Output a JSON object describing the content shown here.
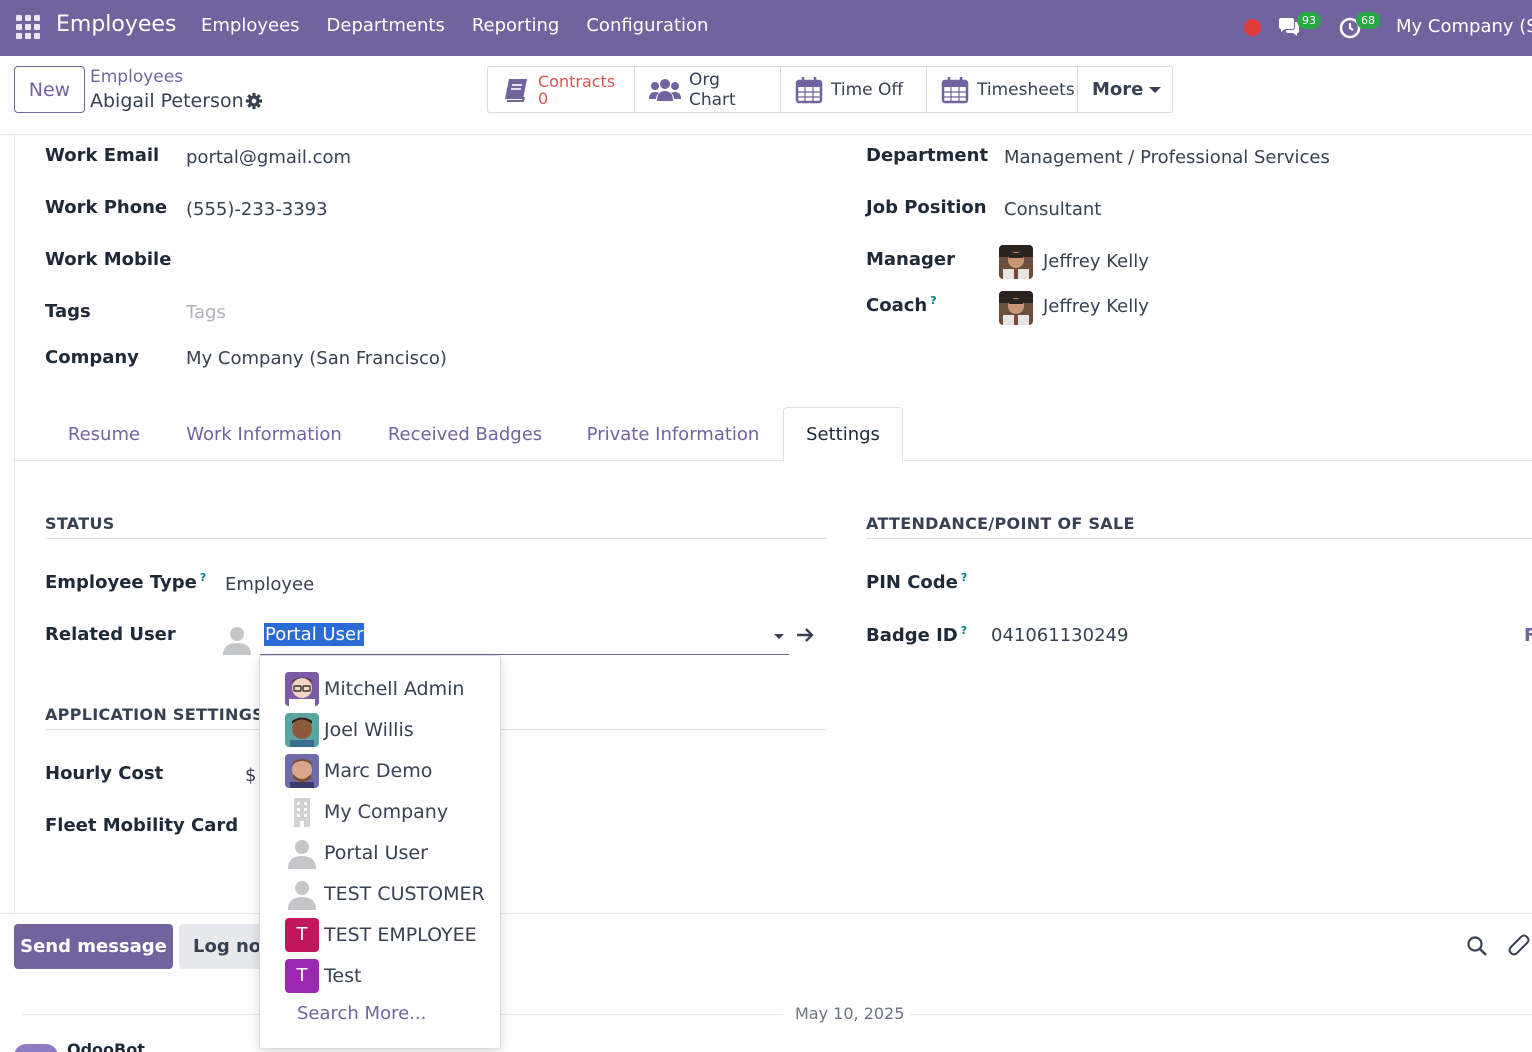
{
  "navbar": {
    "app_title": "Employees",
    "menu": [
      "Employees",
      "Departments",
      "Reporting",
      "Configuration"
    ],
    "chat_count": "93",
    "activity_count": "68",
    "company": "My Company (S"
  },
  "control": {
    "new_label": "New",
    "breadcrumb_parent": "Employees",
    "breadcrumb_current": "Abigail Peterson",
    "smart_buttons": {
      "contracts_label": "Contracts",
      "contracts_count": "0",
      "org_chart": "Org Chart",
      "time_off": "Time Off",
      "timesheets": "Timesheets",
      "more": "More"
    }
  },
  "fields_left": [
    {
      "label": "Work Email",
      "value": "portal@gmail.com"
    },
    {
      "label": "Work Phone",
      "value": "(555)-233-3393"
    },
    {
      "label": "Work Mobile",
      "value": ""
    },
    {
      "label": "Tags",
      "placeholder": "Tags"
    },
    {
      "label": "Company",
      "value": "My Company (San Francisco)"
    }
  ],
  "fields_right": [
    {
      "label": "Department",
      "value": "Management / Professional Services"
    },
    {
      "label": "Job Position",
      "value": "Consultant"
    },
    {
      "label": "Manager",
      "value": "Jeffrey Kelly"
    },
    {
      "label": "Coach",
      "value": "Jeffrey Kelly"
    }
  ],
  "tabs": [
    "Resume",
    "Work Information",
    "Received Badges",
    "Private Information",
    "Settings"
  ],
  "settings": {
    "status_title": "STATUS",
    "employee_type_label": "Employee Type",
    "employee_type_value": "Employee",
    "related_user_label": "Related User",
    "related_user_value": "Portal User",
    "app_settings_title": "APPLICATION SETTINGS",
    "hourly_cost_label": "Hourly Cost",
    "hourly_cost_currency": "$",
    "fleet_card_label": "Fleet Mobility Card",
    "attendance_title": "ATTENDANCE/POINT OF SALE",
    "pin_label": "PIN Code",
    "badge_label": "Badge ID",
    "badge_value": "041061130249",
    "edge_char": "F"
  },
  "dropdown": {
    "items": [
      {
        "label": "Mitchell Admin",
        "avatar": "photo"
      },
      {
        "label": "Joel Willis",
        "avatar": "photo"
      },
      {
        "label": "Marc Demo",
        "avatar": "photo"
      },
      {
        "label": "My Company",
        "avatar": "building"
      },
      {
        "label": "Portal User",
        "avatar": "person"
      },
      {
        "label": "TEST CUSTOMER",
        "avatar": "person"
      },
      {
        "label": "TEST EMPLOYEE",
        "avatar": "T"
      },
      {
        "label": "Test",
        "avatar": "T"
      }
    ],
    "search_more": "Search More..."
  },
  "chatter": {
    "send_message": "Send message",
    "log_note": "Log note",
    "date": "May 10, 2025",
    "author": "OdooBot"
  },
  "colors": {
    "brand": "#71639e",
    "contracts": "#d9534f",
    "badge_green": "#28a745",
    "selection": "#2b6bd6",
    "avatar_t1": "#c2185b",
    "avatar_t2": "#9c27b0"
  }
}
